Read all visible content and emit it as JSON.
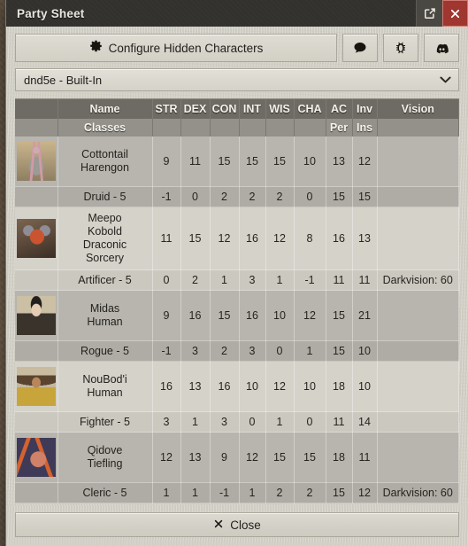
{
  "window": {
    "title": "Party Sheet",
    "popout_icon": "popout-icon",
    "close_icon": "close-icon"
  },
  "toolbar": {
    "configure_label": "Configure Hidden Characters",
    "gear_icon": "gear-icon",
    "chat_icon": "comment-icon",
    "bug_icon": "bug-icon",
    "discord_icon": "discord-icon"
  },
  "system_select": {
    "value": "dnd5e - Built-In",
    "chevron_icon": "chevron-down-icon"
  },
  "table": {
    "headers": [
      "",
      "Name",
      "STR",
      "DEX",
      "CON",
      "INT",
      "WIS",
      "CHA",
      "AC",
      "Inv",
      "Vision"
    ],
    "subheaders": [
      "",
      "Classes",
      "",
      "",
      "",
      "",
      "",
      "",
      "Per",
      "Ins",
      ""
    ],
    "rows": [
      {
        "portrait": "harengon-portrait",
        "name": [
          "Cottontail",
          "Harengon"
        ],
        "stats": [
          "9",
          "11",
          "15",
          "15",
          "15",
          "10",
          "13",
          "12"
        ],
        "vision": "",
        "class": "Druid - 5",
        "mods": [
          "-1",
          "0",
          "2",
          "2",
          "2",
          "0",
          "15",
          "15"
        ],
        "class_vision": ""
      },
      {
        "portrait": "kobold-portrait",
        "name": [
          "Meepo",
          "Kobold",
          "Draconic",
          "Sorcery"
        ],
        "stats": [
          "11",
          "15",
          "12",
          "16",
          "12",
          "8",
          "16",
          "13"
        ],
        "vision": "",
        "class": "Artificer - 5",
        "mods": [
          "0",
          "2",
          "1",
          "3",
          "1",
          "-1",
          "11",
          "11"
        ],
        "class_vision": "Darkvision: 60"
      },
      {
        "portrait": "human-midas-portrait",
        "name": [
          "Midas",
          "Human"
        ],
        "stats": [
          "9",
          "16",
          "15",
          "16",
          "10",
          "12",
          "15",
          "21"
        ],
        "vision": "",
        "class": "Rogue - 5",
        "mods": [
          "-1",
          "3",
          "2",
          "3",
          "0",
          "1",
          "15",
          "10"
        ],
        "class_vision": ""
      },
      {
        "portrait": "human-noubodi-portrait",
        "name": [
          "NouBod'i",
          "Human"
        ],
        "stats": [
          "16",
          "13",
          "16",
          "10",
          "12",
          "10",
          "18",
          "10"
        ],
        "vision": "",
        "class": "Fighter - 5",
        "mods": [
          "3",
          "1",
          "3",
          "0",
          "1",
          "0",
          "11",
          "14"
        ],
        "class_vision": ""
      },
      {
        "portrait": "tiefling-portrait",
        "name": [
          "Qidove",
          "Tiefling"
        ],
        "stats": [
          "12",
          "13",
          "9",
          "12",
          "15",
          "15",
          "18",
          "11"
        ],
        "vision": "",
        "class": "Cleric - 5",
        "mods": [
          "1",
          "1",
          "-1",
          "1",
          "2",
          "2",
          "15",
          "12"
        ],
        "class_vision": "Darkvision: 60"
      }
    ]
  },
  "footer": {
    "close_label": "Close",
    "close_icon": "x-icon"
  },
  "colors": {
    "titlebar": "#33312d",
    "close_button": "#9f3630",
    "header_row": "#6d6b64",
    "subheader_row": "#93918a",
    "row_dark": "#b7b5ae",
    "row_light": "#d4d2c9",
    "window_bg": "#cfcdc3"
  }
}
